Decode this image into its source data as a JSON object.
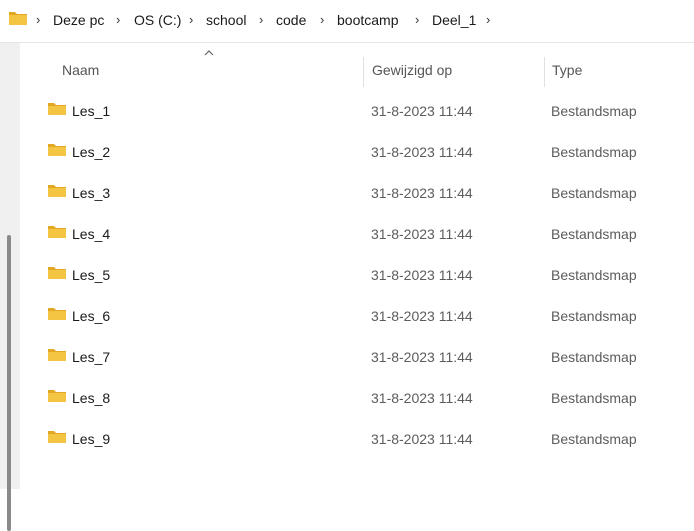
{
  "breadcrumb": {
    "items": [
      "Deze pc",
      "OS (C:)",
      "school",
      "code",
      "bootcamp",
      "Deel_1"
    ]
  },
  "columns": {
    "name": "Naam",
    "modified": "Gewijzigd op",
    "type": "Type"
  },
  "files": [
    {
      "name": "Les_1",
      "modified": "31-8-2023 11:44",
      "type": "Bestandsmap"
    },
    {
      "name": "Les_2",
      "modified": "31-8-2023 11:44",
      "type": "Bestandsmap"
    },
    {
      "name": "Les_3",
      "modified": "31-8-2023 11:44",
      "type": "Bestandsmap"
    },
    {
      "name": "Les_4",
      "modified": "31-8-2023 11:44",
      "type": "Bestandsmap"
    },
    {
      "name": "Les_5",
      "modified": "31-8-2023 11:44",
      "type": "Bestandsmap"
    },
    {
      "name": "Les_6",
      "modified": "31-8-2023 11:44",
      "type": "Bestandsmap"
    },
    {
      "name": "Les_7",
      "modified": "31-8-2023 11:44",
      "type": "Bestandsmap"
    },
    {
      "name": "Les_8",
      "modified": "31-8-2023 11:44",
      "type": "Bestandsmap"
    },
    {
      "name": "Les_9",
      "modified": "31-8-2023 11:44",
      "type": "Bestandsmap"
    }
  ],
  "colors": {
    "folder": "#f4c542",
    "folder_dark": "#e2a823"
  }
}
